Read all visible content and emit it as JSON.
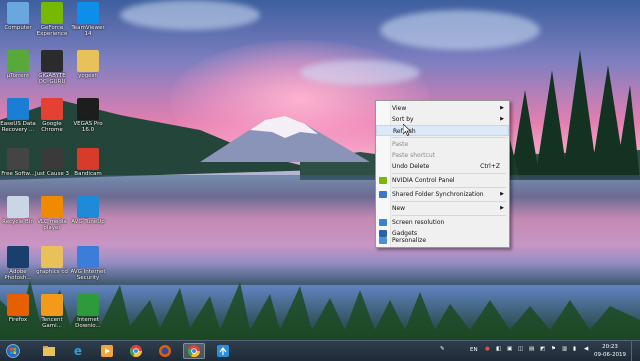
{
  "desktop_icons": [
    {
      "label": "Computer",
      "icon": "computer-icon",
      "color": "#6aa7e0"
    },
    {
      "label": "GeForce Experience",
      "icon": "nvidia-icon",
      "color": "#76b900"
    },
    {
      "label": "TeamViewer 14",
      "icon": "teamviewer-icon",
      "color": "#0e8ee9"
    },
    {
      "label": "µTorrent",
      "icon": "utorrent-icon",
      "color": "#57a93a"
    },
    {
      "label": "GIGABYTE OC_GURU",
      "icon": "gigabyte-icon",
      "color": "#2b2b2b"
    },
    {
      "label": "yogesh",
      "icon": "folder-icon",
      "color": "#e8c15a"
    },
    {
      "label": "EaseUS Data Recovery ...",
      "icon": "easeus-icon",
      "color": "#1a7fd4"
    },
    {
      "label": "Google Chrome",
      "icon": "chrome-icon",
      "color": "#e44134"
    },
    {
      "label": "VEGAS Pro 16.0",
      "icon": "vegas-icon",
      "color": "#1d1d1d"
    },
    {
      "label": "Free Softw...",
      "icon": "free-software-icon",
      "color": "#444444"
    },
    {
      "label": "Just Cause 3",
      "icon": "just-cause-icon",
      "color": "#3a3a3a"
    },
    {
      "label": "Bandicam",
      "icon": "bandicam-icon",
      "color": "#d83b2b"
    },
    {
      "label": "Recycle Bin",
      "icon": "recycle-bin-icon",
      "color": "#c9d6e3"
    },
    {
      "label": "VLC media player",
      "icon": "vlc-icon",
      "color": "#f08a00"
    },
    {
      "label": "AVG TuneUp",
      "icon": "avg-tuneup-icon",
      "color": "#1f8ad7"
    },
    {
      "label": "Adobe Photosh...",
      "icon": "photoshop-icon",
      "color": "#1a3f6d"
    },
    {
      "label": "graphics cd",
      "icon": "folder-icon",
      "color": "#e8c15a"
    },
    {
      "label": "AVG Internet Security",
      "icon": "avg-icon",
      "color": "#3b7dd8"
    },
    {
      "label": "Firefox",
      "icon": "firefox-icon",
      "color": "#e66000"
    },
    {
      "label": "Tencent Gami...",
      "icon": "tencent-icon",
      "color": "#f49a1b"
    },
    {
      "label": "Internet Downlo...",
      "icon": "idm-icon",
      "color": "#2e9a3c"
    }
  ],
  "context_menu": {
    "view": "View",
    "sort_by": "Sort by",
    "refresh": "Refresh",
    "paste": "Paste",
    "paste_shortcut": "Paste shortcut",
    "undo_delete": "Undo Delete",
    "undo_delete_shortcut": "Ctrl+Z",
    "nvidia": "NVIDIA Control Panel",
    "shared_folder": "Shared Folder Synchronization",
    "new": "New",
    "screen_resolution": "Screen resolution",
    "gadgets": "Gadgets",
    "personalize": "Personalize"
  },
  "taskbar": {
    "apps": [
      "start-orb-icon",
      "explorer-icon",
      "internet-explorer-icon",
      "media-player-icon",
      "chrome-icon",
      "firefox-icon",
      "chrome-icon",
      "network-icon"
    ],
    "language": "EN",
    "time": "20:23",
    "date": "09-06-2019"
  }
}
